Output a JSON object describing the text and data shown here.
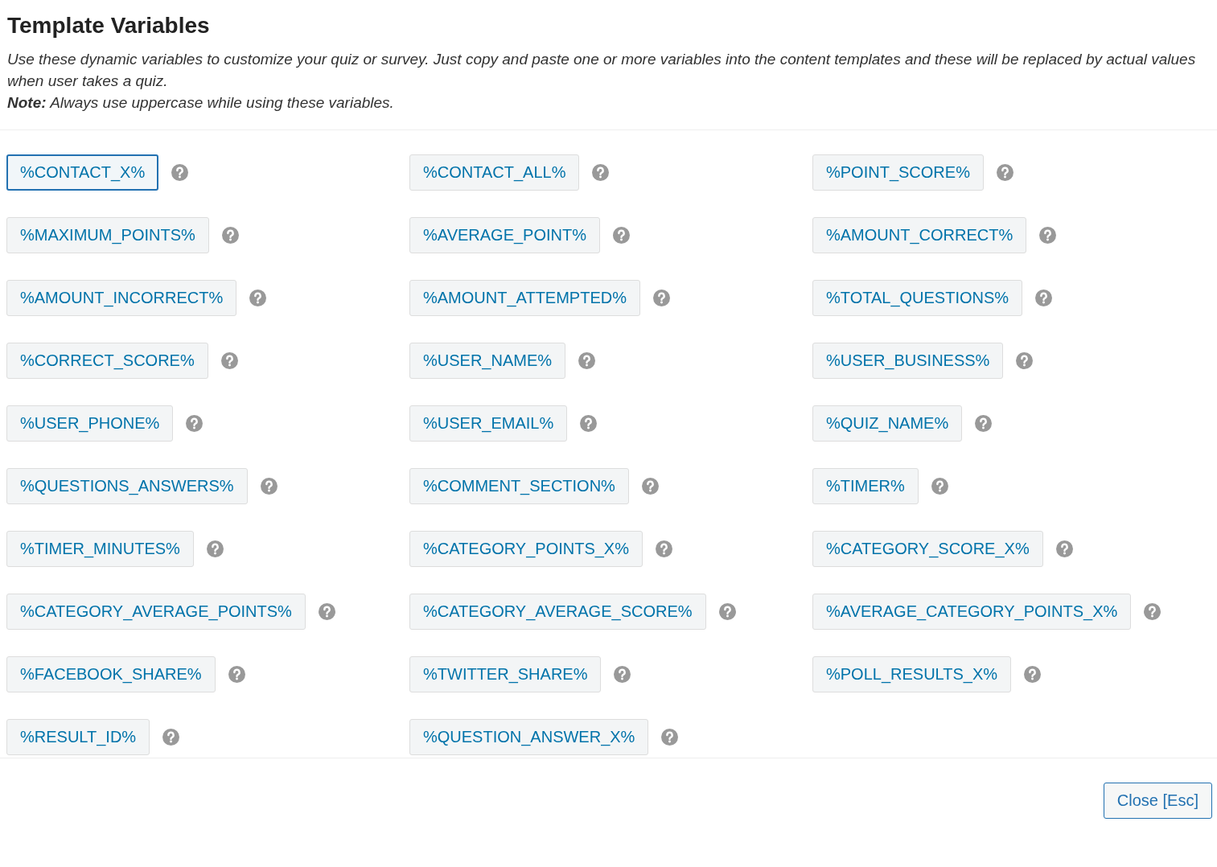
{
  "title": "Template Variables",
  "description": "Use these dynamic variables to customize your quiz or survey. Just copy and paste one or more variables into the content templates and these will be replaced by actual values when user takes a quiz.",
  "note": "**Note:** Always use uppercase while using these variables.",
  "variables": [
    {
      "label": "%CONTACT_X%",
      "focused": true
    },
    {
      "label": "%CONTACT_ALL%",
      "focused": false
    },
    {
      "label": "%POINT_SCORE%",
      "focused": false
    },
    {
      "label": "%MAXIMUM_POINTS%",
      "focused": false
    },
    {
      "label": "%AVERAGE_POINT%",
      "focused": false
    },
    {
      "label": "%AMOUNT_CORRECT%",
      "focused": false
    },
    {
      "label": "%AMOUNT_INCORRECT%",
      "focused": false
    },
    {
      "label": "%AMOUNT_ATTEMPTED%",
      "focused": false
    },
    {
      "label": "%TOTAL_QUESTIONS%",
      "focused": false
    },
    {
      "label": "%CORRECT_SCORE%",
      "focused": false
    },
    {
      "label": "%USER_NAME%",
      "focused": false
    },
    {
      "label": "%USER_BUSINESS%",
      "focused": false
    },
    {
      "label": "%USER_PHONE%",
      "focused": false
    },
    {
      "label": "%USER_EMAIL%",
      "focused": false
    },
    {
      "label": "%QUIZ_NAME%",
      "focused": false
    },
    {
      "label": "%QUESTIONS_ANSWERS%",
      "focused": false
    },
    {
      "label": "%COMMENT_SECTION%",
      "focused": false
    },
    {
      "label": "%TIMER%",
      "focused": false
    },
    {
      "label": "%TIMER_MINUTES%",
      "focused": false
    },
    {
      "label": "%CATEGORY_POINTS_X%",
      "focused": false
    },
    {
      "label": "%CATEGORY_SCORE_X%",
      "focused": false
    },
    {
      "label": "%CATEGORY_AVERAGE_POINTS%",
      "focused": false
    },
    {
      "label": "%CATEGORY_AVERAGE_SCORE%",
      "focused": false
    },
    {
      "label": "%AVERAGE_CATEGORY_POINTS_X%",
      "focused": false
    },
    {
      "label": "%FACEBOOK_SHARE%",
      "focused": false
    },
    {
      "label": "%TWITTER_SHARE%",
      "focused": false
    },
    {
      "label": "%POLL_RESULTS_X%",
      "focused": false
    },
    {
      "label": "%RESULT_ID%",
      "focused": false
    },
    {
      "label": "%QUESTION_ANSWER_X%",
      "focused": false
    }
  ],
  "close_button": "Close [Esc]"
}
